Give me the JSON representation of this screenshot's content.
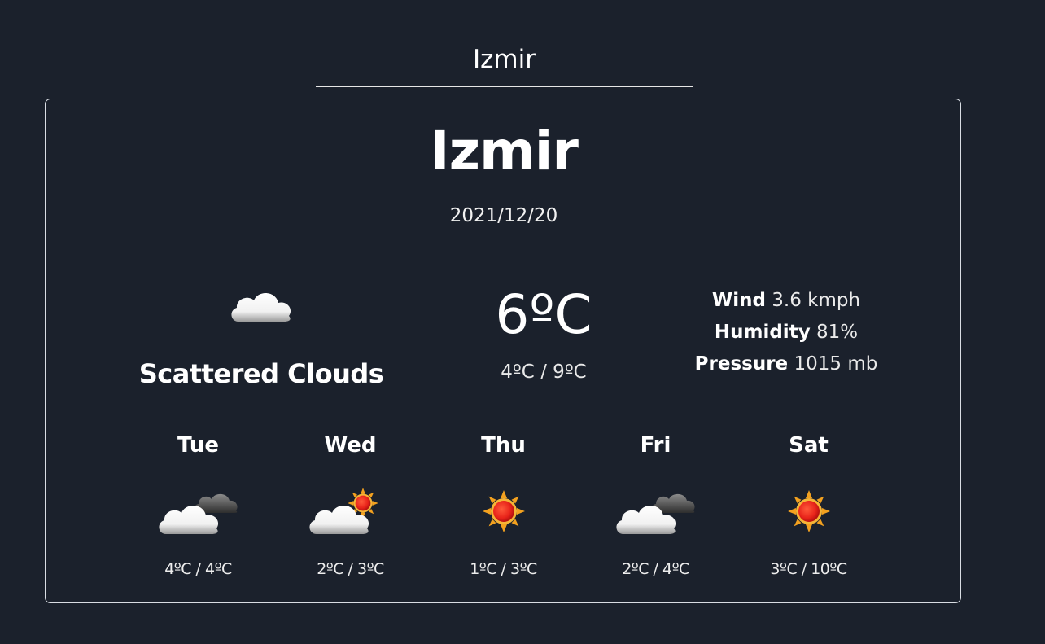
{
  "search": {
    "value": "Izmir"
  },
  "current": {
    "city": "Izmir",
    "date": "2021/12/20",
    "condition": "Scattered Clouds",
    "condition_icon": "cloud-icon",
    "temperature": "6ºC",
    "range": "4ºC / 9ºC",
    "wind_label": "Wind",
    "wind_value": "3.6 kmph",
    "humidity_label": "Humidity",
    "humidity_value": "81%",
    "pressure_label": "Pressure",
    "pressure_value": "1015 mb"
  },
  "forecast": [
    {
      "day": "Tue",
      "range": "4ºC / 4ºC",
      "icon": "cloudy-icon"
    },
    {
      "day": "Wed",
      "range": "2ºC / 3ºC",
      "icon": "partly-sunny-icon"
    },
    {
      "day": "Thu",
      "range": "1ºC / 3ºC",
      "icon": "sun-icon"
    },
    {
      "day": "Fri",
      "range": "2ºC / 4ºC",
      "icon": "cloudy-icon"
    },
    {
      "day": "Sat",
      "range": "3ºC / 10ºC",
      "icon": "sun-icon"
    }
  ],
  "colors": {
    "background": "#1b212c",
    "card_border": "#d9dde3",
    "text": "#ffffff",
    "sun_core": "#e8231a",
    "sun_rays": "#f3a11f"
  }
}
